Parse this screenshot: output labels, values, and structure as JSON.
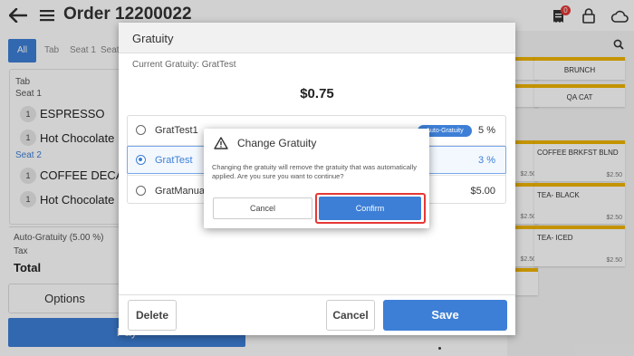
{
  "header": {
    "order_title": "Order 12200022",
    "receipt_badge": "0"
  },
  "order_tabs": {
    "all": "All",
    "tab": "Tab",
    "seat1": "Seat 1",
    "seat_partial": "Seat"
  },
  "order": {
    "section_label": "Tab",
    "seats": [
      {
        "label": "Seat 1",
        "items": [
          {
            "qty": "1",
            "name": "ESPRESSO"
          },
          {
            "qty": "1",
            "name": "Hot Chocolate"
          }
        ]
      },
      {
        "label": "Seat 2",
        "items": [
          {
            "qty": "1",
            "name": "COFFEE DECAF"
          },
          {
            "qty": "1",
            "name": "Hot Chocolate"
          }
        ]
      }
    ],
    "auto_gratuity": "Auto-Gratuity (5.00 %)",
    "tax": "Tax",
    "total": "Total"
  },
  "left_actions": {
    "options": "Options",
    "pay": "Pay"
  },
  "menu_tiles": [
    {
      "name": "BRUNCH",
      "price": ""
    },
    {
      "name": "QA CAT",
      "price": ""
    },
    {
      "name": "COFFEE BRKFST BLND",
      "price": "$2.50"
    },
    {
      "name": "TEA- BLACK",
      "price": "$2.50"
    },
    {
      "name": "TEA- ICED",
      "price": "$2.50"
    }
  ],
  "menu_stub_prices": [
    "$2.50",
    "$2.50",
    "$2.50",
    "$2.50",
    "$2.50"
  ],
  "gratuity_dialog": {
    "title": "Gratuity",
    "current_gratuity": "Current Gratuity: GratTest",
    "amount": "$0.75",
    "options": [
      {
        "name": "GratTest1",
        "badge": "Auto-Gratuity",
        "value": "5 %",
        "selected": false
      },
      {
        "name": "GratTest",
        "value": "3 %",
        "selected": true
      },
      {
        "name": "GratManual",
        "value": "$5.00",
        "selected": false
      }
    ],
    "delete": "Delete",
    "cancel": "Cancel",
    "save": "Save"
  },
  "confirm_dialog": {
    "title": "Change Gratuity",
    "message": "Changing the gratuity will remove the gratuity that was automatically applied. Are you sure you want to continue?",
    "cancel": "Cancel",
    "confirm": "Confirm"
  },
  "colors": {
    "primary": "#3d7fd6",
    "tile_accent": "#f0b400",
    "highlight": "#e53935"
  }
}
